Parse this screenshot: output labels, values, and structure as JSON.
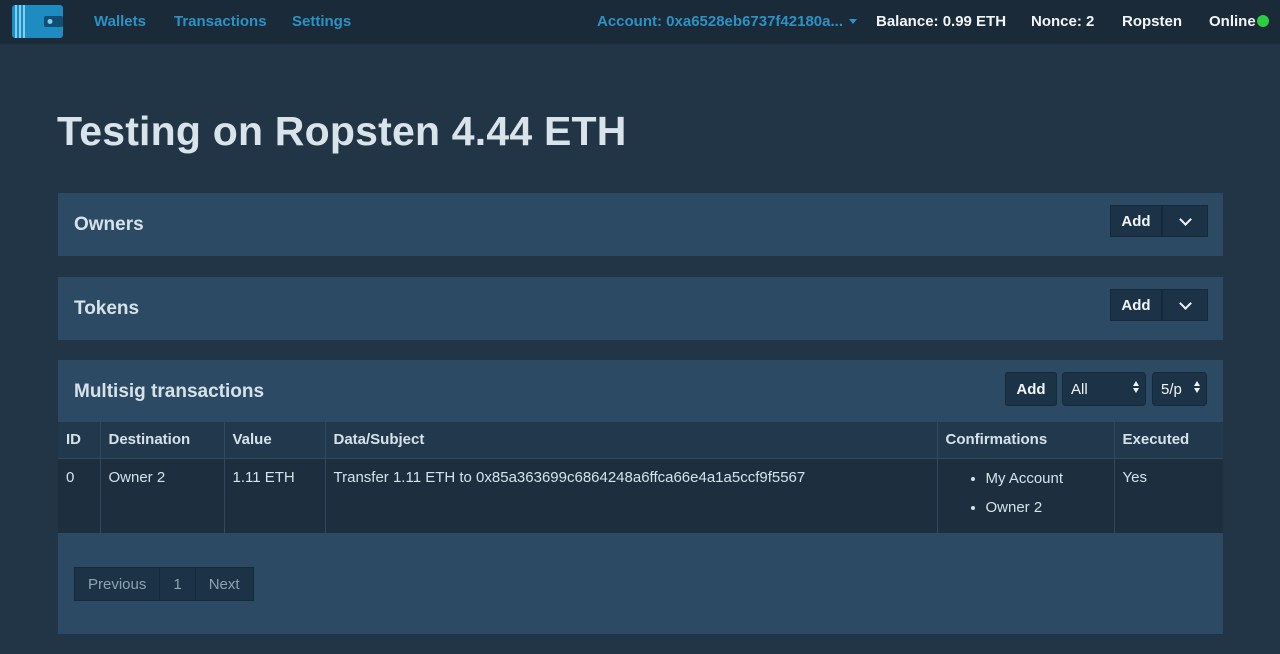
{
  "navbar": {
    "logo_icon": "wallet-icon",
    "links": [
      "Wallets",
      "Transactions",
      "Settings"
    ],
    "account_label": "Account: 0xa6528eb6737f42180a...",
    "balance": "Balance: 0.99 ETH",
    "nonce": "Nonce: 2",
    "network": "Ropsten",
    "status": "Online",
    "status_color": "#2ecc40",
    "accent_color": "#2b93c4"
  },
  "page": {
    "title": "Testing on Ropsten 4.44 ETH"
  },
  "owners_panel": {
    "title": "Owners",
    "add_label": "Add",
    "toggle_icon": "chevron-down-icon"
  },
  "tokens_panel": {
    "title": "Tokens",
    "add_label": "Add",
    "toggle_icon": "chevron-down-icon"
  },
  "multisig_panel": {
    "title": "Multisig transactions",
    "add_label": "Add",
    "filter_value": "All",
    "per_page_value": "5/p",
    "columns": [
      "ID",
      "Destination",
      "Value",
      "Data/Subject",
      "Confirmations",
      "Executed"
    ],
    "rows": [
      {
        "id": "0",
        "destination": "Owner 2",
        "value": "1.11 ETH",
        "data": "Transfer 1.11 ETH to 0x85a363699c6864248a6ffca66e4a1a5ccf9f5567",
        "confirmations": [
          "My Account",
          "Owner 2"
        ],
        "executed": "Yes"
      }
    ],
    "pagination": {
      "previous": "Previous",
      "page": "1",
      "next": "Next"
    }
  }
}
